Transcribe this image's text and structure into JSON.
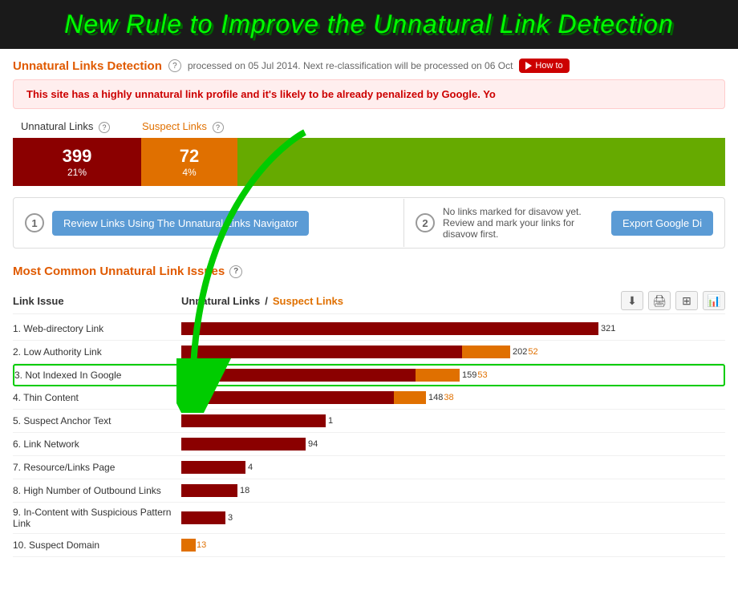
{
  "header": {
    "title": "New Rule to Improve the Unnatural Link Detection"
  },
  "section": {
    "title": "Unnatural Links Detection",
    "processed_text": "processed on 05 Jul 2014. Next re-classification will be processed on 06 Oct",
    "howto_label": "How to"
  },
  "alert": {
    "message": "This site has a highly unnatural link profile and it's likely to be already penalized by Google. Yo"
  },
  "stats": {
    "unnatural_label": "Unnatural Links",
    "suspect_label": "Suspect Links",
    "unnatural_count": "399",
    "unnatural_pct": "21%",
    "suspect_count": "72",
    "suspect_pct": "4%"
  },
  "actions": {
    "step1_number": "1",
    "step1_button": "Review Links Using The Unnatural Links Navigator",
    "step2_number": "2",
    "step2_text": "No links marked for disavow yet. Review and mark your links for disavow first.",
    "step2_button": "Export Google Di"
  },
  "common_section": {
    "title": "Most Common Unnatural Link Issues",
    "col_issue": "Link Issue",
    "col_unnatural": "Unnatural Links",
    "col_separator": "/",
    "col_suspect": "Suspect Links"
  },
  "rows": [
    {
      "label": "1. Web-directory Link",
      "red_width": 520,
      "red_val": "321",
      "orange_width": 0,
      "orange_val": "",
      "highlighted": false
    },
    {
      "label": "2. Low Authority Link",
      "red_width": 350,
      "red_val": "202",
      "orange_width": 60,
      "orange_val": "52",
      "highlighted": false
    },
    {
      "label": "3. Not Indexed In Google",
      "red_width": 290,
      "red_val": "159",
      "orange_width": 55,
      "orange_val": "53",
      "highlighted": true
    },
    {
      "label": "4. Thin Content",
      "red_width": 265,
      "red_val": "148",
      "orange_width": 40,
      "orange_val": "38",
      "highlighted": false
    },
    {
      "label": "5. Suspect Anchor Text",
      "red_width": 180,
      "red_val": "1",
      "orange_width": 0,
      "orange_val": "",
      "highlighted": false
    },
    {
      "label": "6. Link Network",
      "red_width": 155,
      "red_val": "94",
      "orange_width": 0,
      "orange_val": "",
      "highlighted": false
    },
    {
      "label": "7. Resource/Links Page",
      "red_width": 80,
      "red_val": "4",
      "orange_width": 0,
      "orange_val": "",
      "highlighted": false
    },
    {
      "label": "8. High Number of Outbound Links",
      "red_width": 70,
      "red_val": "18",
      "orange_width": 0,
      "orange_val": "",
      "highlighted": false
    },
    {
      "label": "9. In-Content with Suspicious Pattern Link",
      "red_width": 55,
      "red_val": "3",
      "orange_width": 0,
      "orange_val": "",
      "highlighted": false
    },
    {
      "label": "10. Suspect Domain",
      "red_width": 0,
      "red_val": "",
      "orange_width": 18,
      "orange_val": "13",
      "highlighted": false
    }
  ],
  "icons": {
    "download": "⬇",
    "print": "🖨",
    "grid": "⊞",
    "export": "📊"
  }
}
